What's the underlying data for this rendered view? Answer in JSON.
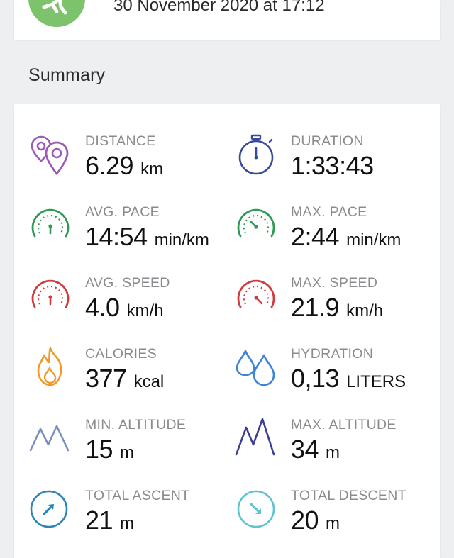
{
  "header": {
    "date_text": "30 November 2020 at 17:12",
    "badge_color": "#7cc36b",
    "badge_icon": "walker-icon"
  },
  "summary": {
    "title": "Summary",
    "stats": [
      {
        "label": "DISTANCE",
        "value": "6.29",
        "unit": "km",
        "icon": "location-pins-icon",
        "color": "#9c59b6"
      },
      {
        "label": "DURATION",
        "value": "1:33:43",
        "unit": "",
        "icon": "stopwatch-icon",
        "color": "#3a4a9b"
      },
      {
        "label": "AVG. PACE",
        "value": "14:54",
        "unit": "min/km",
        "icon": "pace-gauge-icon",
        "color": "#2f9a55"
      },
      {
        "label": "MAX. PACE",
        "value": "2:44",
        "unit": "min/km",
        "icon": "max-pace-gauge-icon",
        "color": "#2f9a55"
      },
      {
        "label": "AVG. SPEED",
        "value": "4.0",
        "unit": "km/h",
        "icon": "speed-gauge-icon",
        "color": "#d23b3b"
      },
      {
        "label": "MAX. SPEED",
        "value": "21.9",
        "unit": "km/h",
        "icon": "max-speed-gauge-icon",
        "color": "#d23b3b"
      },
      {
        "label": "CALORIES",
        "value": "377",
        "unit": "kcal",
        "icon": "flame-icon",
        "color": "#f09a2a"
      },
      {
        "label": "HYDRATION",
        "value": "0,13",
        "unit": "LITERS",
        "icon": "water-drops-icon",
        "color": "#3d86d6"
      },
      {
        "label": "MIN. ALTITUDE",
        "value": "15",
        "unit": "m",
        "icon": "low-mountain-icon",
        "color": "#7a8fc0"
      },
      {
        "label": "MAX. ALTITUDE",
        "value": "34",
        "unit": "m",
        "icon": "high-mountain-icon",
        "color": "#3b3f8f"
      },
      {
        "label": "TOTAL ASCENT",
        "value": "21",
        "unit": "m",
        "icon": "ascent-arrow-icon",
        "color": "#2a86b8"
      },
      {
        "label": "TOTAL DESCENT",
        "value": "20",
        "unit": "m",
        "icon": "descent-arrow-icon",
        "color": "#5fc4cf"
      }
    ]
  }
}
